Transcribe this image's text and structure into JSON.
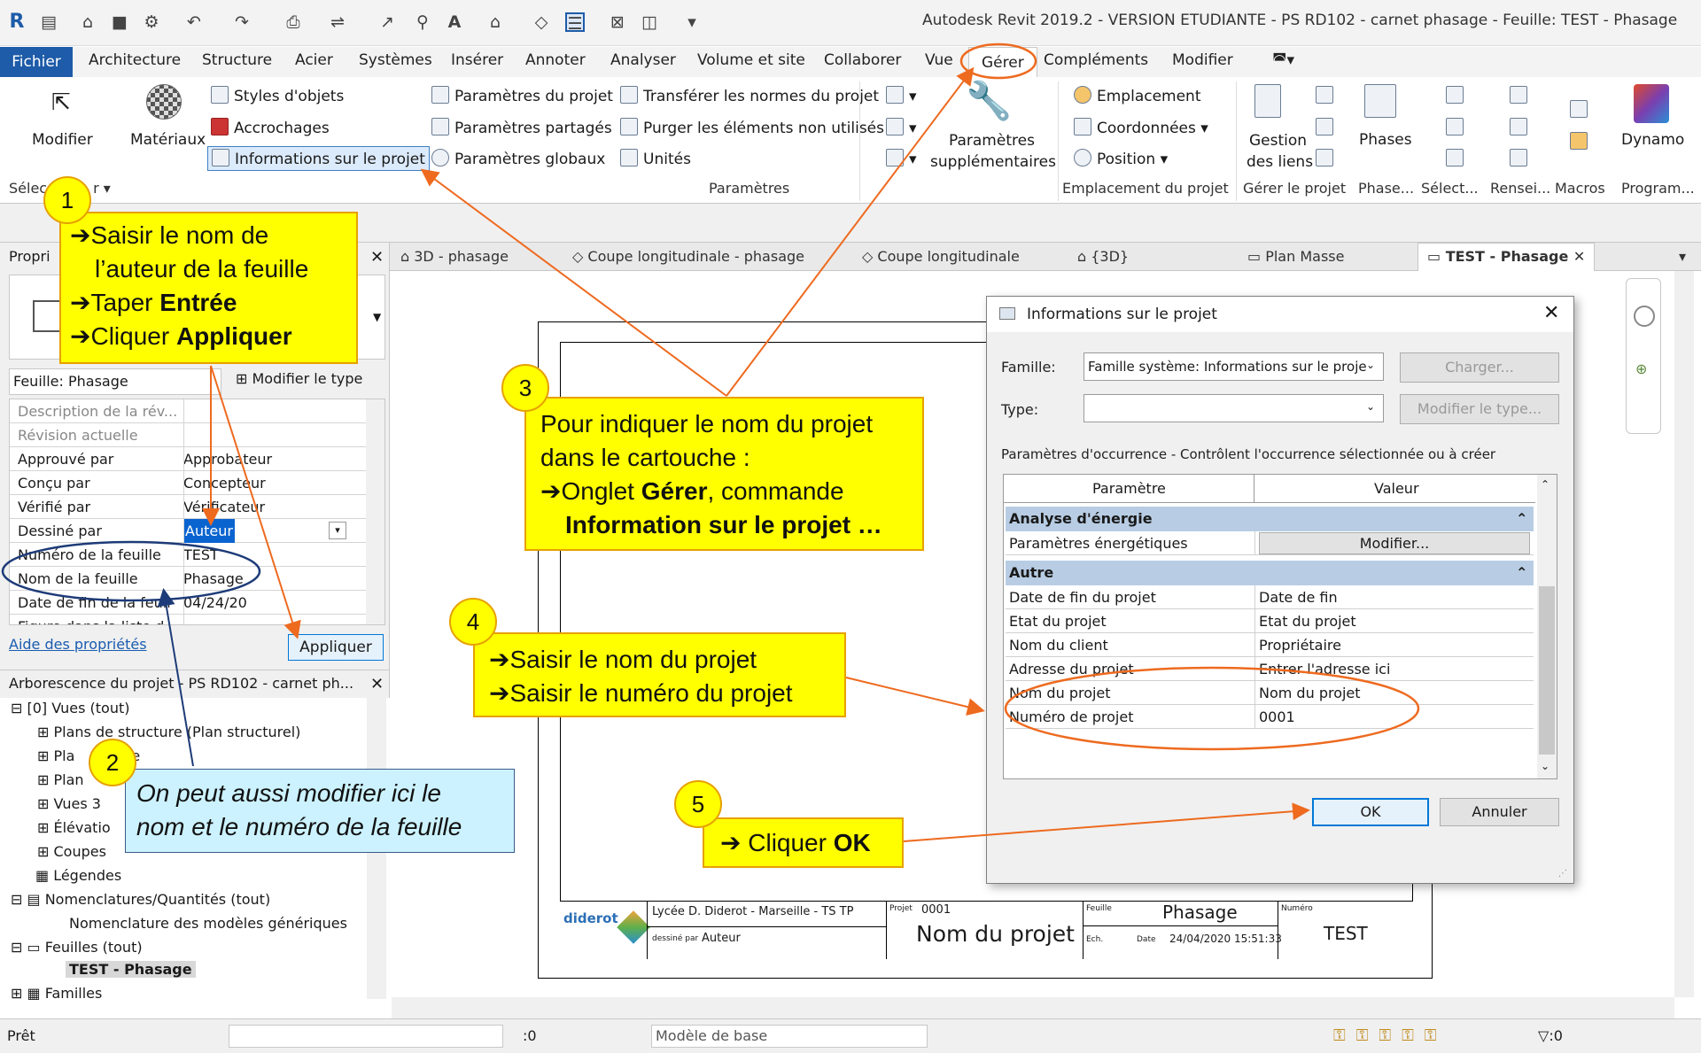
{
  "app": {
    "title": "Autodesk Revit 2019.2 - VERSION ETUDIANTE - PS RD102 - carnet phasage  - Feuille: TEST - Phasage"
  },
  "menu": {
    "tabs": [
      "Fichier",
      "Architecture",
      "Structure",
      "Acier",
      "Systèmes",
      "Insérer",
      "Annoter",
      "Analyser",
      "Volume et site",
      "Collaborer",
      "Vue",
      "Gérer",
      "Compléments",
      "Modifier"
    ]
  },
  "ribbon": {
    "modifier": "Modifier",
    "materiaux": "Matériaux",
    "styles_objets": "Styles d'objets",
    "accrochages": "Accrochages",
    "info_projet": "Informations sur le projet",
    "params_projet": "Paramètres du projet",
    "params_partages": "Paramètres partagés",
    "params_globaux": "Paramètres  globaux",
    "transferer": "Transférer les normes du projet",
    "purger": "Purger les éléments non utilisés",
    "unites": "Unités",
    "params_supp_1": "Paramètres",
    "params_supp_2": "supplémentaires",
    "emplacement": "Emplacement",
    "coordonnees": "Coordonnées",
    "position": "Position",
    "gestion_1": "Gestion",
    "gestion_2": "des liens",
    "phases": "Phases",
    "dynamo": "Dynamo",
    "group_select": "Sélec",
    "group_select_tail": "r",
    "group_params": "Paramètres",
    "group_emplacement": "Emplacement du projet",
    "group_gerer": "Gérer le projet",
    "group_phase": "Phase...",
    "group_selection": "Sélect...",
    "group_rensei": "Rensei...",
    "group_macros": "Macros",
    "group_program": "Program..."
  },
  "view_tabs": [
    {
      "label": "3D - phasage"
    },
    {
      "label": "Coupe longitudinale - phasage"
    },
    {
      "label": "Coupe longitudinale"
    },
    {
      "label": "{3D}"
    },
    {
      "label": "Plan Masse"
    },
    {
      "label": "TEST - Phasage"
    }
  ],
  "properties": {
    "header": "Propri",
    "type_selector": "Feuille: Phasage",
    "edit_type": "Modifier le type",
    "rows": [
      {
        "k": "Description de la rév...",
        "v": "",
        "dim": true
      },
      {
        "k": "Révision actuelle",
        "v": "",
        "dim": true
      },
      {
        "k": "Approuvé par",
        "v": "Approbateur"
      },
      {
        "k": "Conçu par",
        "v": "Concepteur"
      },
      {
        "k": "Vérifié par",
        "v": "Vérificateur"
      },
      {
        "k": "Dessiné par",
        "v": "Auteur"
      },
      {
        "k": "Numéro de la feuille",
        "v": "TEST"
      },
      {
        "k": "Nom de la feuille",
        "v": "Phasage"
      },
      {
        "k": "Date de fin de la feuil",
        "v": "04/24/20"
      },
      {
        "k": "Figure dans la liste d...",
        "v": ""
      }
    ],
    "help_link": "Aide des propriétés",
    "apply": "Appliquer"
  },
  "browser": {
    "title": "Arborescence du projet - PS RD102 - carnet ph...",
    "items": [
      {
        "label": "[0] Vues (tout)"
      },
      {
        "label": "Plans de structure (Plan structurel)"
      },
      {
        "label": "Pla"
      },
      {
        "label": "age"
      },
      {
        "label": "Plan"
      },
      {
        "label": "Vues 3"
      },
      {
        "label": "Élévatio"
      },
      {
        "label": "Coupes"
      },
      {
        "label": "Légendes"
      },
      {
        "label": "Nomenclatures/Quantités (tout)"
      },
      {
        "label": "Nomenclature des modèles génériques"
      },
      {
        "label": "Feuilles (tout)"
      },
      {
        "label": "TEST - Phasage"
      },
      {
        "label": "Familles"
      }
    ]
  },
  "titleblock": {
    "school": "Lycée D. Diderot - Marseille - TS TP",
    "logo": "diderot",
    "drawn_by_label": "dessiné par",
    "drawn_by": "Auteur",
    "project_label": "Projet",
    "project_number": "0001",
    "project_name": "Nom du projet",
    "sheet_label": "Feuille",
    "sheet_name": "Phasage",
    "scale_label": "Ech.",
    "date_label": "Date",
    "date": "24/04/2020 15:51:33",
    "number_label": "Numéro",
    "number": "TEST"
  },
  "dialog": {
    "title": "Informations sur le projet",
    "famille_label": "Famille:",
    "famille_value": "Famille système: Informations sur le proje",
    "type_label": "Type:",
    "charger": "Charger...",
    "modifier_type": "Modifier le type...",
    "description": "Paramètres d'occurrence - Contrôlent l'occurrence sélectionnée ou à créer",
    "col_param": "Paramètre",
    "col_value": "Valeur",
    "group1": "Analyse d'énergie",
    "energy_param": "Paramètres énergétiques",
    "energy_btn": "Modifier...",
    "group2": "Autre",
    "rows": [
      {
        "k": "Date de fin du projet",
        "v": "Date de fin"
      },
      {
        "k": "Etat du projet",
        "v": "Etat du projet"
      },
      {
        "k": "Nom du client",
        "v": "Propriétaire"
      },
      {
        "k": "Adresse du projet",
        "v": "Entrer l'adresse ici"
      },
      {
        "k": "Nom du projet",
        "v": "Nom du projet"
      },
      {
        "k": "Numéro de projet",
        "v": "0001"
      }
    ],
    "ok": "OK",
    "cancel": "Annuler"
  },
  "callouts": {
    "n1": "1",
    "n2": "2",
    "n3": "3",
    "n4": "4",
    "n5": "5",
    "c1_l1": "Saisir le nom de",
    "c1_l2": "l’auteur de la feuille",
    "c1_l3a": "Taper ",
    "c1_l3b": "Entrée",
    "c1_l4a": "Cliquer ",
    "c1_l4b": "Appliquer",
    "c2_l1": "On peut aussi modifier ici le",
    "c2_l2": "nom et le numéro de la feuille",
    "c3_l1": "Pour indiquer le nom du projet",
    "c3_l2": "dans le cartouche :",
    "c3_l3a": "Onglet ",
    "c3_l3b": "Gérer",
    "c3_l3c": ", commande",
    "c3_l4": "Information sur le projet …",
    "c4_l1": "Saisir le nom du projet",
    "c4_l2": "Saisir le numéro du projet",
    "c5_a": "Cliquer ",
    "c5_b": "OK"
  },
  "status": {
    "ready": "Prêt",
    "zero1": ":0",
    "model": "Modèle de base",
    "zero2": ":0"
  },
  "colors": {
    "accent": "#1e5ba8",
    "callout": "#ffff00",
    "arrow": "#ee6a1f",
    "blue_callout": "#ccf2ff"
  }
}
